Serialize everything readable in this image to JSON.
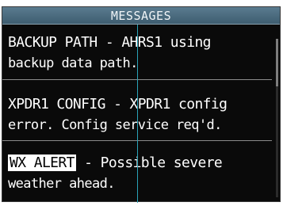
{
  "title": "MESSAGES",
  "messages": [
    {
      "line1": "BACKUP PATH - AHRS1 using",
      "line2": "backup data path."
    },
    {
      "line1": "XPDR1 CONFIG - XPDR1 config",
      "line2": "error. Config service req'd."
    },
    {
      "tag": "WX ALERT",
      "line1_rest": " - Possible severe",
      "line2": "weather ahead."
    }
  ],
  "colors": {
    "background": "#0a0a0a",
    "title_bar": "#4a6b7f",
    "text": "#ffffff",
    "cursor_line": "#2aa3b8"
  }
}
